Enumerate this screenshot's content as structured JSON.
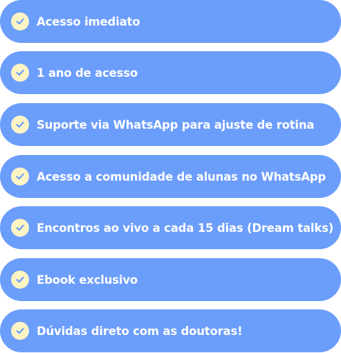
{
  "colors": {
    "pill_background": "#6b9dfb",
    "check_circle": "#fdf4c4",
    "check_mark": "#6b9dfb",
    "text": "#ffffff"
  },
  "benefits": [
    {
      "label": "Acesso imediato",
      "icon": "check-icon"
    },
    {
      "label": "1 ano de acesso",
      "icon": "check-icon"
    },
    {
      "label": "Suporte via WhatsApp para ajuste de rotina",
      "icon": "check-icon"
    },
    {
      "label": "Acesso a comunidade de alunas no WhatsApp",
      "icon": "check-icon"
    },
    {
      "label": "Encontros ao vivo a cada 15 dias (Dream talks)",
      "icon": "check-icon"
    },
    {
      "label": "Ebook exclusivo",
      "icon": "check-icon"
    },
    {
      "label": "Dúvidas direto com as doutoras!",
      "icon": "check-icon"
    }
  ]
}
